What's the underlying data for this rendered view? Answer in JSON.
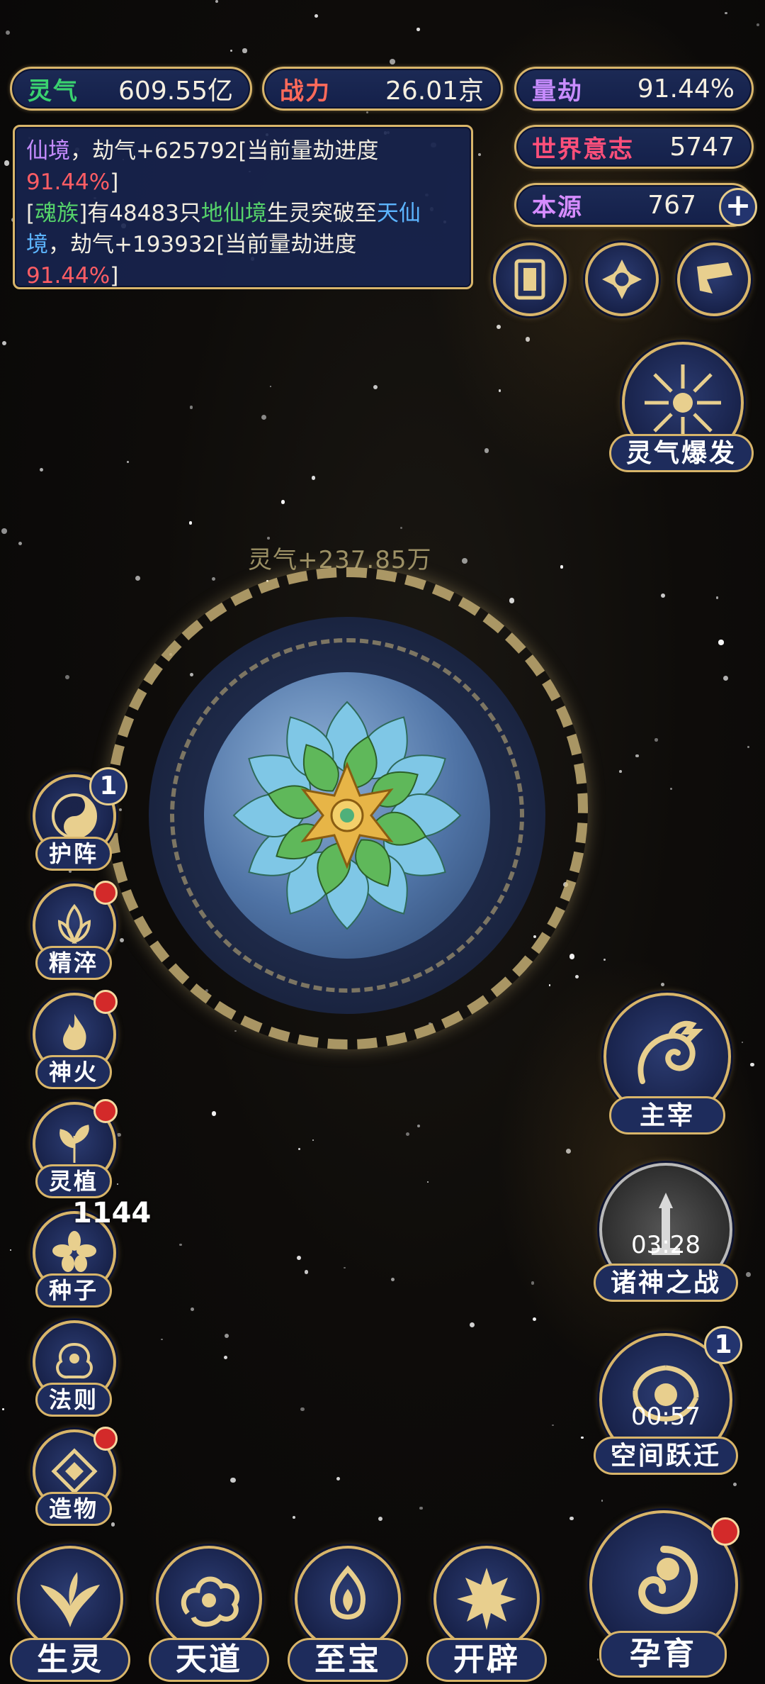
{
  "stats": {
    "lingqi": {
      "label": "灵气",
      "value": "609.55亿"
    },
    "zhanli": {
      "label": "战力",
      "value": "26.01京"
    },
    "liangjie": {
      "label": "量劫",
      "value": "91.44%"
    },
    "shijie_yizhi": {
      "label": "世界意志",
      "value": "5747"
    },
    "benyuan": {
      "label": "本源",
      "value": "767",
      "add_symbol": "+"
    }
  },
  "log": {
    "line1_realm": "仙境",
    "line1_text": "，劫气+625792[当前量劫进度",
    "line1_progress": "91.44%",
    "line1_tail": "]",
    "line2_open": "[",
    "line2_race": "魂族",
    "line2_mid": "]有48483只",
    "line2_from": "地仙境",
    "line2_mid2": "生灵突破至",
    "line2_to": "天仙境",
    "line2_text": "，劫气+193932[当前量劫进度",
    "line2_progress": "91.44%",
    "line2_tail": "]"
  },
  "floating_gain": "灵气+237.85万",
  "right_buttons": {
    "burst": {
      "label": "灵气爆发"
    },
    "master": {
      "label": "主宰"
    },
    "war": {
      "label": "诸神之战",
      "timer": "03:28"
    },
    "leap": {
      "label": "空间跃迁",
      "timer": "00:57",
      "badge": "1"
    }
  },
  "side_buttons": [
    {
      "label": "护阵",
      "badge": "1"
    },
    {
      "label": "精淬"
    },
    {
      "label": "神火"
    },
    {
      "label": "灵植"
    },
    {
      "label": "种子",
      "count": "1144"
    },
    {
      "label": "法则"
    },
    {
      "label": "造物"
    }
  ],
  "nav": [
    {
      "label": "生灵"
    },
    {
      "label": "天道"
    },
    {
      "label": "至宝"
    },
    {
      "label": "开辟"
    },
    {
      "label": "孕育"
    }
  ],
  "colors": {
    "gold": "#d8b56a",
    "panel": "#1c2a55",
    "lingqi_label": "#3ad26f",
    "zhanli_label": "#ff6a5a",
    "liangjie_label": "#c88cff",
    "shijie_label": "#ff4f7a",
    "benyuan_label": "#d68cff"
  }
}
